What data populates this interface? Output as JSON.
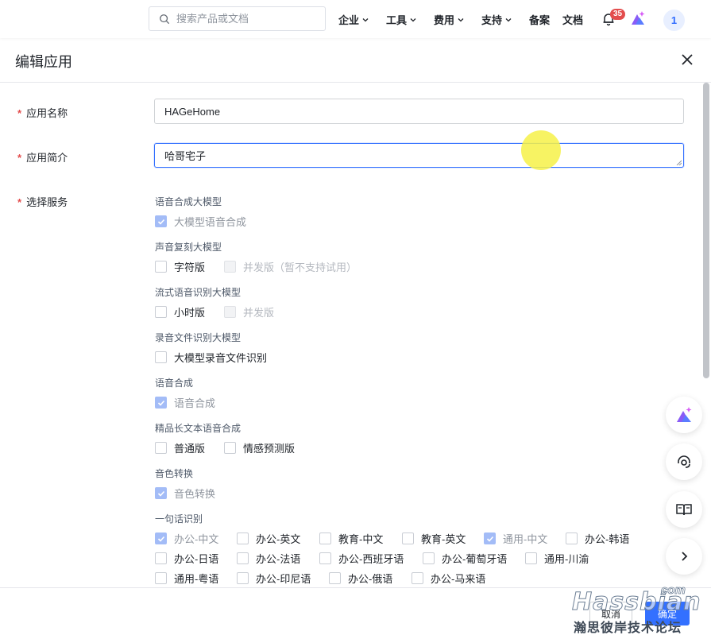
{
  "nav": {
    "search_placeholder": "搜索产品或文档",
    "items": [
      {
        "label": "企业",
        "dropdown": true
      },
      {
        "label": "工具",
        "dropdown": true
      },
      {
        "label": "费用",
        "dropdown": true
      },
      {
        "label": "支持",
        "dropdown": true
      },
      {
        "label": "备案",
        "dropdown": false
      },
      {
        "label": "文档",
        "dropdown": false
      }
    ],
    "notification_count": "35",
    "avatar_text": "1"
  },
  "drawer": {
    "title": "编辑应用"
  },
  "form": {
    "app_name_label": "应用名称",
    "app_name_value": "HAGeHome",
    "app_desc_label": "应用简介",
    "app_desc_value": "哈哥宅子",
    "services_label": "选择服务",
    "groups": [
      {
        "title": "语音合成大模型",
        "options": [
          {
            "label": "大模型语音合成",
            "state": "checked-disabled"
          }
        ]
      },
      {
        "title": "声音复刻大模型",
        "options": [
          {
            "label": "字符版",
            "state": "unchecked"
          },
          {
            "label": "并发版（暂不支持试用）",
            "state": "disabled"
          }
        ]
      },
      {
        "title": "流式语音识别大模型",
        "options": [
          {
            "label": "小时版",
            "state": "unchecked"
          },
          {
            "label": "并发版",
            "state": "disabled"
          }
        ]
      },
      {
        "title": "录音文件识别大模型",
        "options": [
          {
            "label": "大模型录音文件识别",
            "state": "unchecked"
          }
        ]
      },
      {
        "title": "语音合成",
        "options": [
          {
            "label": "语音合成",
            "state": "checked-disabled"
          }
        ]
      },
      {
        "title": "精品长文本语音合成",
        "options": [
          {
            "label": "普通版",
            "state": "unchecked"
          },
          {
            "label": "情感预测版",
            "state": "unchecked"
          }
        ]
      },
      {
        "title": "音色转换",
        "options": [
          {
            "label": "音色转换",
            "state": "checked-disabled"
          }
        ]
      },
      {
        "title": "一句话识别",
        "options": [
          {
            "label": "办公-中文",
            "state": "checked-disabled"
          },
          {
            "label": "办公-英文",
            "state": "unchecked"
          },
          {
            "label": "教育-中文",
            "state": "unchecked"
          },
          {
            "label": "教育-英文",
            "state": "unchecked"
          },
          {
            "label": "通用-中文",
            "state": "checked-disabled"
          },
          {
            "label": "办公-韩语",
            "state": "unchecked"
          },
          {
            "label": "办公-日语",
            "state": "unchecked"
          },
          {
            "label": "办公-法语",
            "state": "unchecked"
          },
          {
            "label": "办公-西班牙语",
            "state": "unchecked"
          },
          {
            "label": "办公-葡萄牙语",
            "state": "unchecked"
          },
          {
            "label": "通用-川渝",
            "state": "unchecked"
          },
          {
            "label": "通用-粤语",
            "state": "unchecked"
          },
          {
            "label": "办公-印尼语",
            "state": "unchecked"
          },
          {
            "label": "办公-俄语",
            "state": "unchecked"
          },
          {
            "label": "办公-马来语",
            "state": "unchecked"
          }
        ]
      }
    ]
  },
  "footer": {
    "cancel_label": "取消",
    "ok_label": "确定"
  },
  "watermark": {
    "brand": "Hassbian",
    "domain": "com",
    "subtitle": "瀚思彼岸技术论坛"
  },
  "colors": {
    "accent": "#3370ff",
    "required": "#e34d4d",
    "checked_disabled": "#a3bcf7"
  }
}
